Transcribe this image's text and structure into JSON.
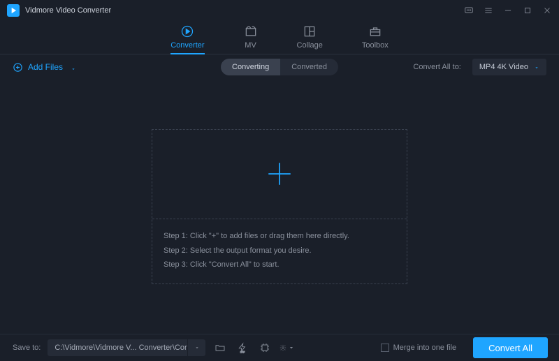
{
  "app": {
    "title": "Vidmore Video Converter"
  },
  "tabs": {
    "converter": "Converter",
    "mv": "MV",
    "collage": "Collage",
    "toolbox": "Toolbox"
  },
  "toolbar": {
    "add_files": "Add Files",
    "converting": "Converting",
    "converted": "Converted",
    "convert_all_to": "Convert All to:",
    "format_selected": "MP4 4K Video"
  },
  "dropzone": {
    "step1": "Step 1: Click \"+\" to add files or drag them here directly.",
    "step2": "Step 2: Select the output format you desire.",
    "step3": "Step 3: Click \"Convert All\" to start."
  },
  "bottom": {
    "save_to": "Save to:",
    "path": "C:\\Vidmore\\Vidmore V... Converter\\Converted",
    "merge": "Merge into one file",
    "convert_all": "Convert All"
  }
}
